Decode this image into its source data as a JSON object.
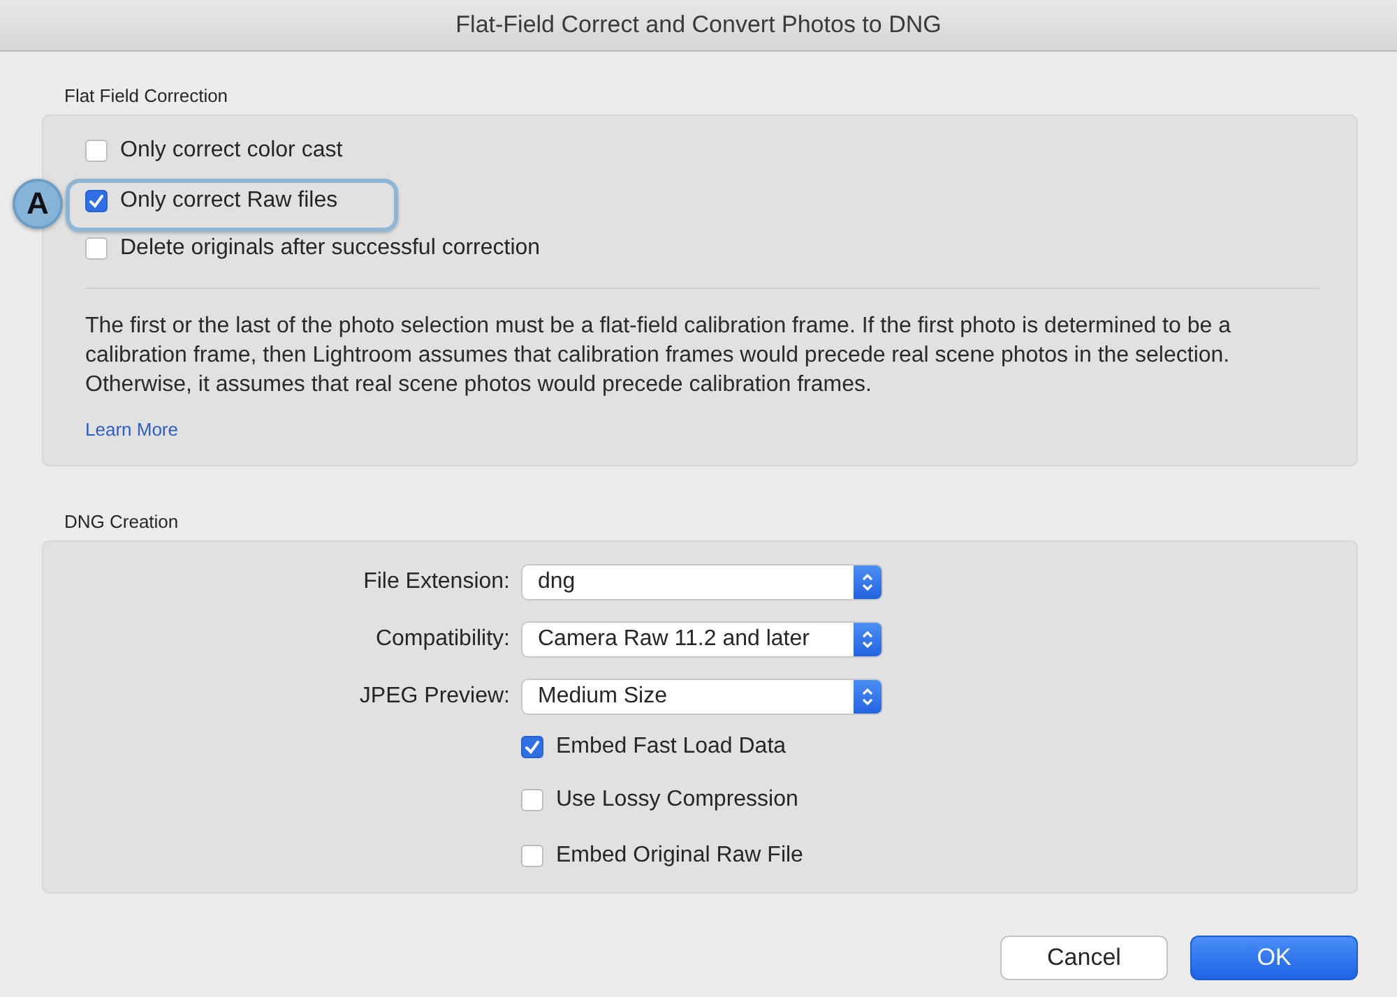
{
  "window": {
    "title": "Flat-Field Correct and Convert Photos to DNG"
  },
  "flat_field_correction": {
    "title": "Flat Field Correction",
    "options": [
      {
        "label": "Only correct color cast",
        "checked": false
      },
      {
        "label": "Only correct Raw files",
        "checked": true,
        "callout": "A"
      },
      {
        "label": "Delete originals after successful correction",
        "checked": false
      }
    ],
    "description": "The first or the last of the photo selection must be a flat-field calibration frame. If the first photo is determined to be a calibration frame, then Lightroom assumes that calibration frames would precede real scene photos in the selection. Otherwise, it assumes that real scene photos would precede calibration frames.",
    "link": "Learn More"
  },
  "dng_creation": {
    "title": "DNG Creation",
    "popups": [
      {
        "label": "File Extension:",
        "value": "dng"
      },
      {
        "label": "Compatibility:",
        "value": "Camera Raw 11.2 and later"
      },
      {
        "label": "JPEG Preview:",
        "value": "Medium Size"
      }
    ],
    "options": [
      {
        "label": "Embed Fast Load Data",
        "checked": true
      },
      {
        "label": "Use Lossy Compression",
        "checked": false
      },
      {
        "label": "Embed Original Raw File",
        "checked": false
      }
    ]
  },
  "buttons": [
    {
      "label": "Cancel",
      "kind": "secondary"
    },
    {
      "label": "OK",
      "kind": "default"
    }
  ]
}
